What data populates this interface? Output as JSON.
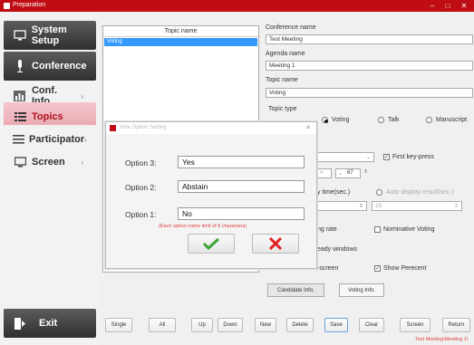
{
  "window": {
    "title": "Preparation",
    "min": "–",
    "max": "□",
    "close": "✕"
  },
  "sidebar": {
    "items": [
      {
        "label": "System Setup",
        "icon": "monitor-icon"
      },
      {
        "label": "Conference",
        "icon": "microphone-icon"
      },
      {
        "label": "Conf. Info.",
        "icon": "chart-icon"
      },
      {
        "label": "Topics",
        "icon": "list-icon"
      },
      {
        "label": "Participator",
        "icon": "list-icon"
      },
      {
        "label": "Screen",
        "icon": "screen-icon"
      }
    ],
    "exit_label": "Exit"
  },
  "topic_list": {
    "header": "Topic name",
    "rows": [
      "Voting"
    ]
  },
  "form": {
    "conference_name_label": "Conference name",
    "conference_name_value": "Test Meeting",
    "agenda_name_label": "Agenda name",
    "agenda_name_value": "Meeting 1",
    "topic_name_label": "Topic name",
    "topic_name_value": "Voting",
    "topic_type_label": "Topic type",
    "topic_type_options": [
      "Voting",
      "Talk",
      "Manuscript"
    ],
    "topic_type_selected": "Voting",
    "first_keypress_label": "First key-press",
    "first_keypress_checked": true,
    "num_select_value": "67",
    "time_label_partial": "y time(sec.)",
    "auto_display_label": "Auto display result(sec.)",
    "auto_display_value": "15",
    "rate_label_partial": "ng rate",
    "nominative_label": "Nominative Voting",
    "ready_label_partial": "eady windows",
    "screen_label_partial": "-screen",
    "show_percent_label": "Show Perecent",
    "show_percent_checked": true,
    "candidate_info_label": "Candidate Info.",
    "voting_info_label": "Voting Info."
  },
  "dialog": {
    "title": "Vote Option Setting",
    "close": "✕",
    "options": [
      {
        "label": "Option 3:",
        "value": "Yes"
      },
      {
        "label": "Option 2:",
        "value": "Abstain"
      },
      {
        "label": "Option 1:",
        "value": "No"
      }
    ],
    "hint": "(Each option name limit of 8 characters)"
  },
  "toolbar": {
    "buttons": [
      "Single",
      "All",
      "Up",
      "Down",
      "New",
      "Delete",
      "Save",
      "Clear",
      "Screen",
      "Return"
    ]
  },
  "status": {
    "text": "Test Meeting\\Meeting 1\\"
  },
  "colors": {
    "brand_red": "#c00d14",
    "selection_blue": "#3399ff",
    "hint_red": "#e04040",
    "confirm_green": "#3aa63a",
    "cancel_red": "#e02020"
  }
}
